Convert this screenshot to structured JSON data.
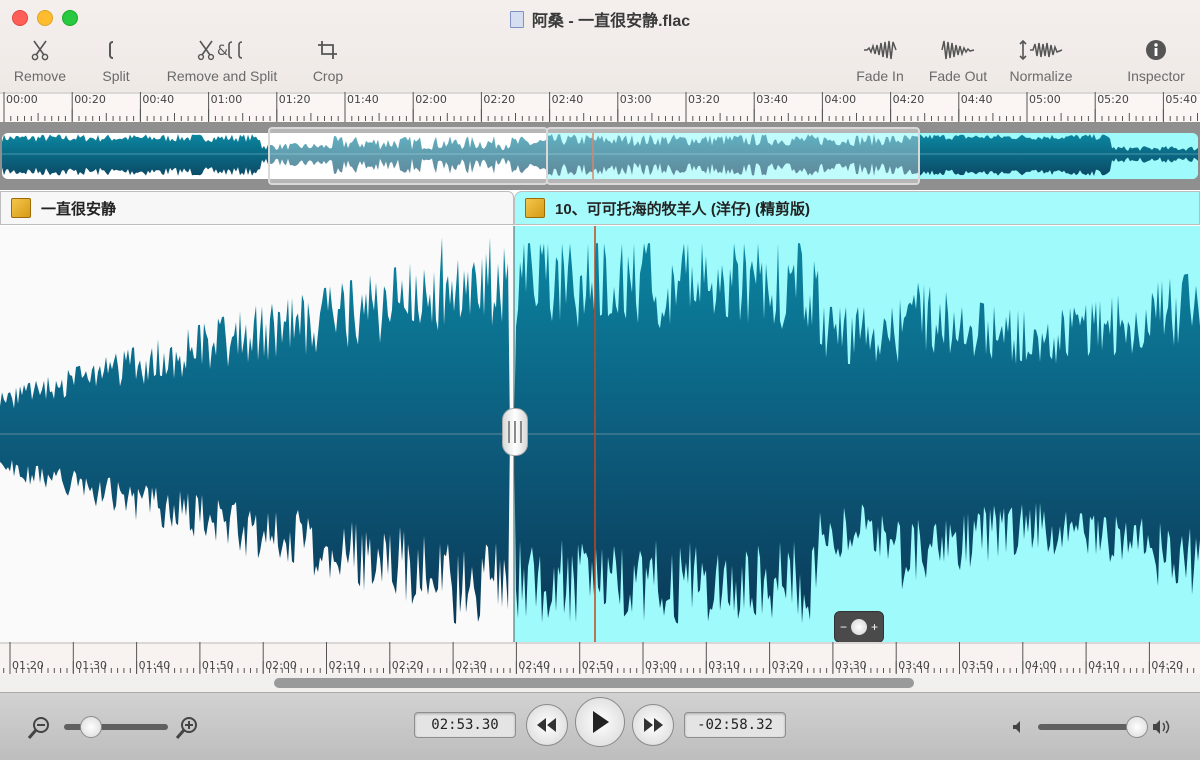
{
  "window": {
    "title": "阿桑 - 一直很安静.flac"
  },
  "toolbar": {
    "remove": "Remove",
    "split": "Split",
    "remove_and_split": "Remove and Split",
    "crop": "Crop",
    "fade_in": "Fade In",
    "fade_out": "Fade Out",
    "normalize": "Normalize",
    "inspector": "Inspector"
  },
  "top_ruler": {
    "labels": [
      "00:00",
      "00:20",
      "00:40",
      "01:00",
      "01:20",
      "01:40",
      "02:00",
      "02:20",
      "02:40",
      "03:00",
      "03:20",
      "03:40",
      "04:00",
      "04:20",
      "04:40",
      "05:00",
      "05:20",
      "05:40"
    ]
  },
  "tracks": [
    {
      "name": "一直很安静"
    },
    {
      "name": "10、可可托海的牧羊人 (洋仔) (精剪版)"
    }
  ],
  "bottom_ruler": {
    "labels": [
      "01:20",
      "01:30",
      "01:40",
      "01:50",
      "02:00",
      "02:10",
      "02:20",
      "02:30",
      "02:40",
      "02:50",
      "03:00",
      "03:10",
      "03:20",
      "03:30",
      "03:40",
      "03:50",
      "04:00",
      "04:10",
      "04:20"
    ]
  },
  "transport": {
    "current_time": "02:53.30",
    "remaining_time": "-02:58.32",
    "zoom_level": 0.25,
    "volume_level": 0.92
  },
  "colors": {
    "wave_dark": "#0f4f6c",
    "wave_mid": "#0a7f9a",
    "selected_bg": "#9ffafb",
    "playhead": "#c2471f"
  }
}
